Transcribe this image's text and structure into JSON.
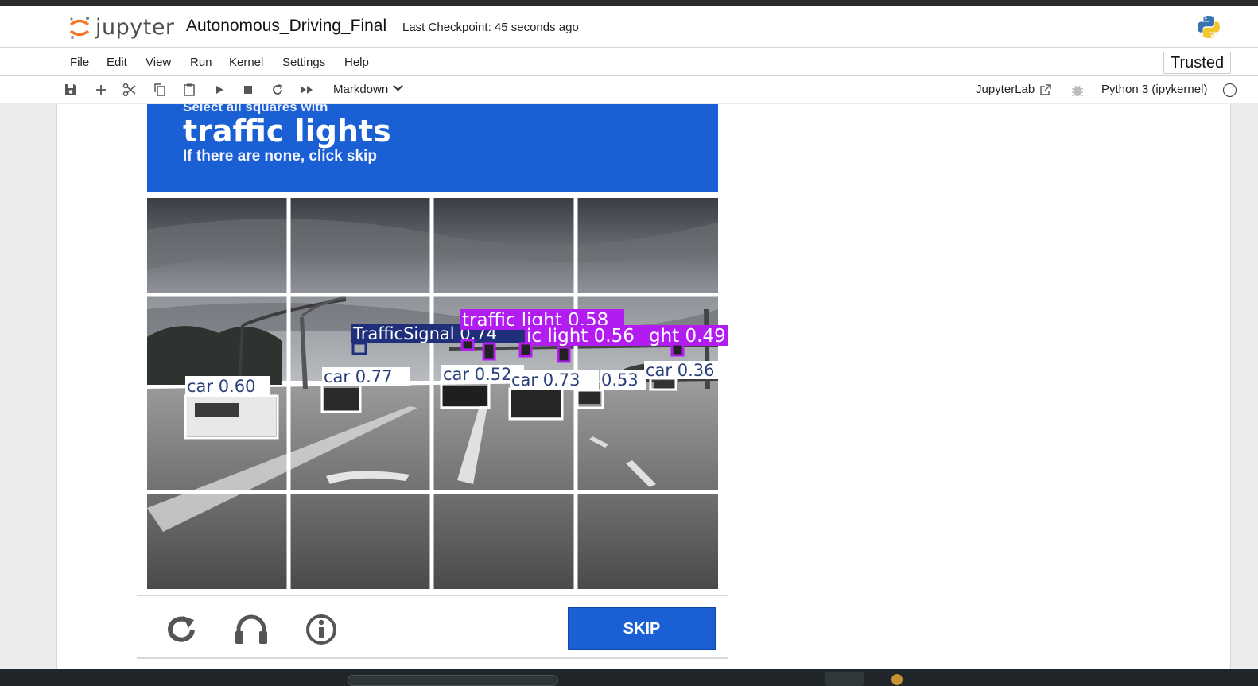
{
  "app": {
    "logo_text": "jupyter",
    "notebook_title": "Autonomous_Driving_Final",
    "checkpoint": "Last Checkpoint: 45 seconds ago"
  },
  "menu": {
    "items": [
      "File",
      "Edit",
      "View",
      "Run",
      "Kernel",
      "Settings",
      "Help"
    ],
    "trusted": "Trusted"
  },
  "toolbar": {
    "cell_type": "Markdown",
    "jupyterlab_link": "JupyterLab",
    "kernel_name": "Python 3 (ipykernel)"
  },
  "captcha": {
    "banner_small": "Select all squares with",
    "banner_big": "traffic lights",
    "banner_sub": "If there are none, click skip",
    "skip_label": "SKIP"
  },
  "detections": {
    "traffic_signal": "TrafficSignal  0.74",
    "traffic_light_1": "traffic  light  0.58",
    "traffic_light_2": "ic  light  0.56",
    "traffic_light_3": "ght  0.49",
    "car_1": "car  0.60",
    "car_2": "car  0.77",
    "car_3": "car  0.52",
    "car_4": "car  0.73",
    "car_5": "0.53",
    "car_6": "car  0.36"
  },
  "colors": {
    "banner_blue": "#1a5fd4",
    "traffic_light_box": "#b21cf0",
    "traffic_signal_box": "#1f2f7a",
    "car_box": "#ffffff"
  }
}
